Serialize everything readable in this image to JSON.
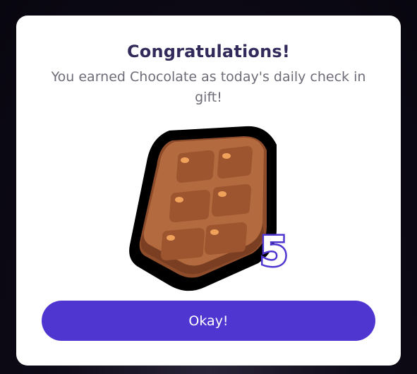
{
  "dialog": {
    "title": "Congratulations!",
    "message": "You earned Chocolate as today's daily check in gift!",
    "reward": {
      "icon": "chocolate-bar-icon",
      "count": "5"
    },
    "confirm_label": "Okay!"
  },
  "colors": {
    "accent": "#5036d1",
    "title": "#322a5a",
    "message": "#6f6c78",
    "chocolate": "#a8603a"
  }
}
